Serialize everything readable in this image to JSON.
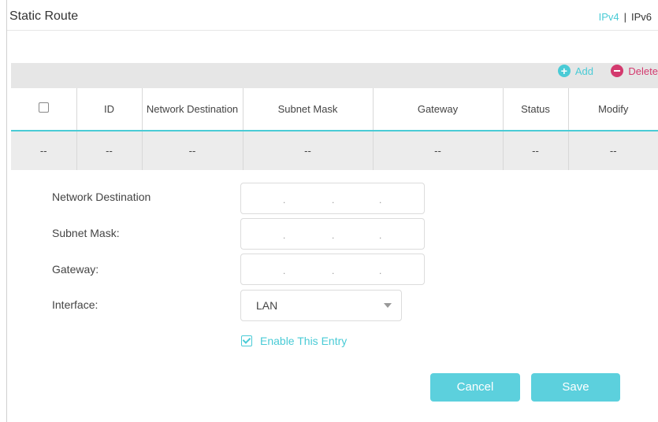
{
  "page": {
    "title": "Static Route",
    "ip_switch": {
      "ipv4": "IPv4",
      "separator": "|",
      "ipv6": "IPv6"
    }
  },
  "toolbar": {
    "add_label": "Add",
    "delete_label": "Delete"
  },
  "table": {
    "columns": [
      "",
      "ID",
      "Network Destination",
      "Subnet Mask",
      "Gateway",
      "Status",
      "Modify"
    ],
    "rows": [
      [
        "--",
        "--",
        "--",
        "--",
        "--",
        "--",
        "--"
      ]
    ]
  },
  "form": {
    "network_destination_label": "Network Destination",
    "subnet_mask_label": "Subnet Mask:",
    "gateway_label": "Gateway:",
    "interface_label": "Interface:",
    "interface_value": "LAN",
    "enable_label": "Enable This Entry",
    "ip_dot": "."
  },
  "buttons": {
    "cancel": "Cancel",
    "save": "Save"
  },
  "colors": {
    "accent": "#4acbd6",
    "delete": "#d33a6e",
    "button": "#5cd0dd"
  }
}
